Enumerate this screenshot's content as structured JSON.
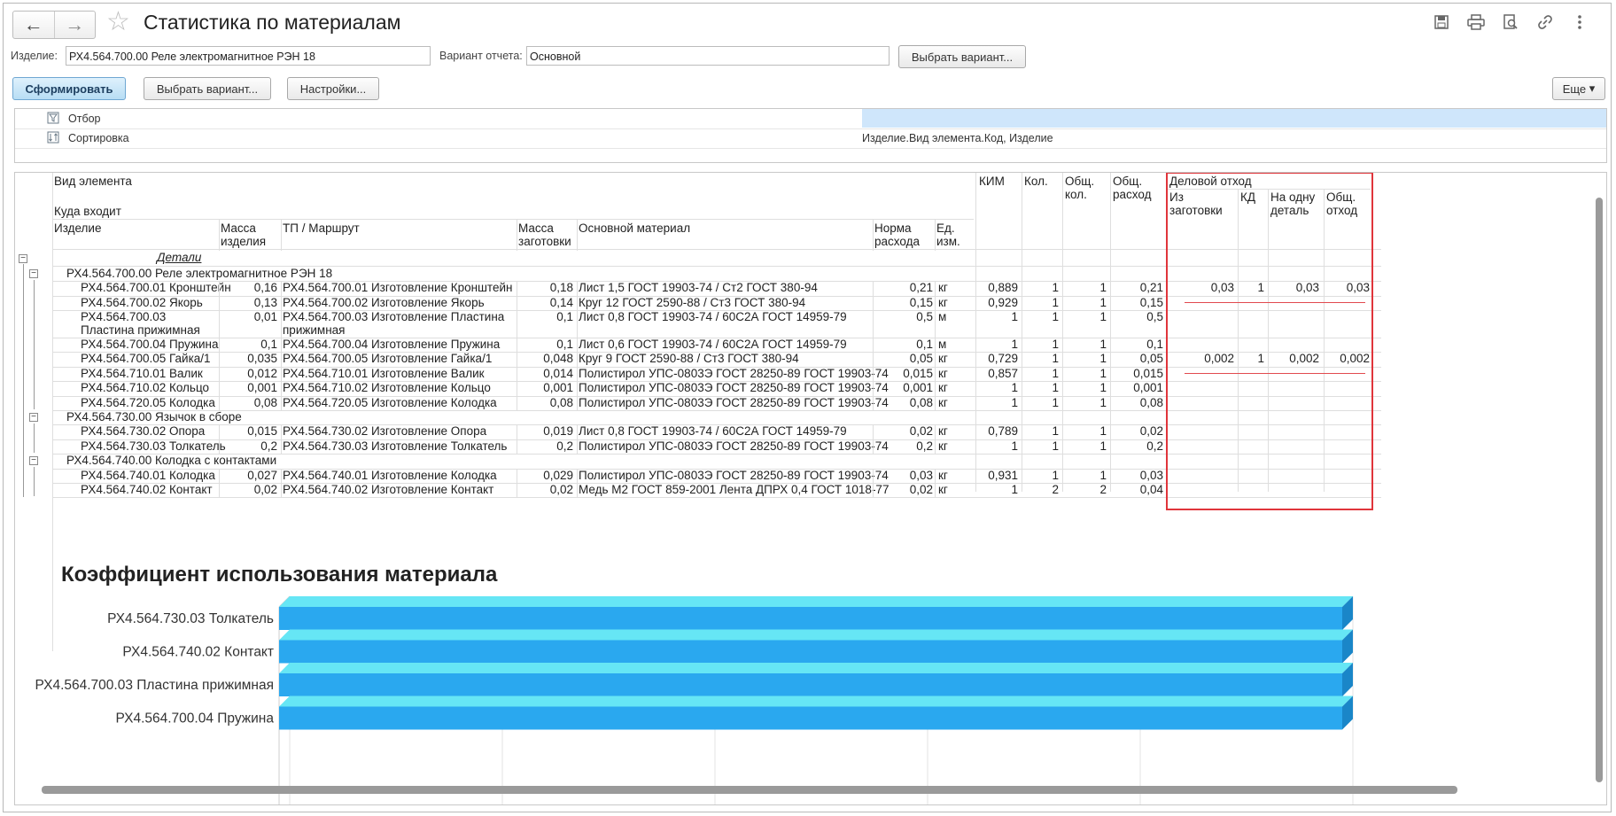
{
  "window": {
    "title": "Статистика по материалам"
  },
  "toolbar": {
    "back": "←",
    "forward": "→",
    "star": "☆",
    "icons": [
      "save-icon",
      "print-icon",
      "preview-icon",
      "link-icon",
      "more-icon"
    ]
  },
  "fields": {
    "product_label": "Изделие:",
    "product_value": "РХ4.564.700.00 Реле электромагнитное РЭН 18",
    "variant_label": "Вариант отчета:",
    "variant_value": "Основной",
    "choose_variant_top": "Выбрать вариант..."
  },
  "actions": {
    "generate": "Сформировать",
    "choose_variant": "Выбрать вариант...",
    "settings": "Настройки...",
    "more": "Еще"
  },
  "settings": {
    "rows": [
      {
        "name": "Отбор",
        "value": ""
      },
      {
        "name": "Сортировка",
        "value": "Изделие.Вид элемента.Код, Изделие"
      }
    ]
  },
  "table": {
    "headers": {
      "element_type": "Вид элемента",
      "goes_to": "Куда входит",
      "product": "Изделие",
      "mass_product": "Масса изделия",
      "tp_route": "ТП / Маршрут",
      "mass_blank": "Масса заготовки",
      "main_material": "Основной материал",
      "consumption_norm": "Норма расхода",
      "unit": "Ед. изм.",
      "kim": "КИМ",
      "qty": "Кол.",
      "total_qty": "Общ. кол.",
      "total_consumption": "Общ. расход",
      "business_waste": "Деловой отход",
      "from_blank": "Из заготовки",
      "kd": "КД",
      "per_part": "На одну деталь",
      "total_waste": "Общ. отход"
    },
    "group_title": "Детали",
    "groups": [
      {
        "name": "РХ4.564.700.00 Реле электромагнитное РЭН 18",
        "rows": [
          {
            "product": "РХ4.564.700.01 Кронштейн",
            "mass": "0,16",
            "tp": "РХ4.564.700.01 Изготовление Кронштейн",
            "mass_blank": "0,18",
            "material": "Лист 1,5  ГОСТ 19903-74 / Ст2  ГОСТ 380-94",
            "norm": "0,21",
            "unit": "кг",
            "kim": "0,889",
            "qty": "1",
            "total_qty": "1",
            "total_cons": "0,21",
            "from_blank": "0,03",
            "kd": "1",
            "per_part": "0,03",
            "total_waste": "0,03"
          },
          {
            "product": "РХ4.564.700.02 Якорь",
            "mass": "0,13",
            "tp": "РХ4.564.700.02 Изготовление Якорь",
            "mass_blank": "0,14",
            "material": "Круг 12  ГОСТ 2590-88 / Ст3  ГОСТ 380-94",
            "norm": "0,15",
            "unit": "кг",
            "kim": "0,929",
            "qty": "1",
            "total_qty": "1",
            "total_cons": "0,15",
            "from_blank": "",
            "kd": "",
            "per_part": "",
            "total_waste": ""
          },
          {
            "product": "РХ4.564.700.03 Пластина прижимная",
            "mass": "0,01",
            "tp": "РХ4.564.700.03 Изготовление Пластина прижимная",
            "mass_blank": "0,1",
            "material": "Лист 0,8  ГОСТ 19903-74 / 60С2А  ГОСТ 14959-79",
            "norm": "0,5",
            "unit": "м",
            "kim": "1",
            "qty": "1",
            "total_qty": "1",
            "total_cons": "0,5",
            "from_blank": "",
            "kd": "",
            "per_part": "",
            "total_waste": ""
          },
          {
            "product": "РХ4.564.700.04 Пружина",
            "mass": "0,1",
            "tp": "РХ4.564.700.04 Изготовление Пружина",
            "mass_blank": "0,1",
            "material": "Лист 0,6  ГОСТ 19903-74 / 60С2А  ГОСТ 14959-79",
            "norm": "0,1",
            "unit": "м",
            "kim": "1",
            "qty": "1",
            "total_qty": "1",
            "total_cons": "0,1",
            "from_blank": "",
            "kd": "",
            "per_part": "",
            "total_waste": ""
          },
          {
            "product": "РХ4.564.700.05 Гайка/1",
            "mass": "0,035",
            "tp": "РХ4.564.700.05 Изготовление Гайка/1",
            "mass_blank": "0,048",
            "material": "Круг 9  ГОСТ 2590-88 / Ст3  ГОСТ 380-94",
            "norm": "0,05",
            "unit": "кг",
            "kim": "0,729",
            "qty": "1",
            "total_qty": "1",
            "total_cons": "0,05",
            "from_blank": "0,002",
            "kd": "1",
            "per_part": "0,002",
            "total_waste": "0,002"
          },
          {
            "product": "РХ4.564.710.01 Валик",
            "mass": "0,012",
            "tp": "РХ4.564.710.01 Изготовление Валик",
            "mass_blank": "0,014",
            "material": "Полистирол УПС-0803Э  ГОСТ 28250-89  ГОСТ 19903-74",
            "norm": "0,015",
            "unit": "кг",
            "kim": "0,857",
            "qty": "1",
            "total_qty": "1",
            "total_cons": "0,015",
            "from_blank": "",
            "kd": "",
            "per_part": "",
            "total_waste": ""
          },
          {
            "product": "РХ4.564.710.02 Кольцо",
            "mass": "0,001",
            "tp": "РХ4.564.710.02 Изготовление Кольцо",
            "mass_blank": "0,001",
            "material": "Полистирол УПС-0803Э  ГОСТ 28250-89  ГОСТ 19903-74",
            "norm": "0,001",
            "unit": "кг",
            "kim": "1",
            "qty": "1",
            "total_qty": "1",
            "total_cons": "0,001",
            "from_blank": "",
            "kd": "",
            "per_part": "",
            "total_waste": ""
          },
          {
            "product": "РХ4.564.720.05 Колодка",
            "mass": "0,08",
            "tp": "РХ4.564.720.05 Изготовление Колодка",
            "mass_blank": "0,08",
            "material": "Полистирол УПС-0803Э  ГОСТ 28250-89  ГОСТ 19903-74",
            "norm": "0,08",
            "unit": "кг",
            "kim": "1",
            "qty": "1",
            "total_qty": "1",
            "total_cons": "0,08",
            "from_blank": "",
            "kd": "",
            "per_part": "",
            "total_waste": ""
          }
        ]
      },
      {
        "name": "РХ4.564.730.00 Язычок в сборе",
        "rows": [
          {
            "product": "РХ4.564.730.02 Опора",
            "mass": "0,015",
            "tp": "РХ4.564.730.02 Изготовление Опора",
            "mass_blank": "0,019",
            "material": "Лист 0,8  ГОСТ 19903-74 / 60С2А  ГОСТ 14959-79",
            "norm": "0,02",
            "unit": "кг",
            "kim": "0,789",
            "qty": "1",
            "total_qty": "1",
            "total_cons": "0,02",
            "from_blank": "",
            "kd": "",
            "per_part": "",
            "total_waste": ""
          },
          {
            "product": "РХ4.564.730.03 Толкатель",
            "mass": "0,2",
            "tp": "РХ4.564.730.03 Изготовление Толкатель",
            "mass_blank": "0,2",
            "material": "Полистирол УПС-0803Э  ГОСТ 28250-89  ГОСТ 19903-74",
            "norm": "0,2",
            "unit": "кг",
            "kim": "1",
            "qty": "1",
            "total_qty": "1",
            "total_cons": "0,2",
            "from_blank": "",
            "kd": "",
            "per_part": "",
            "total_waste": ""
          }
        ]
      },
      {
        "name": "РХ4.564.740.00 Колодка с контактами",
        "rows": [
          {
            "product": "РХ4.564.740.01 Колодка",
            "mass": "0,027",
            "tp": "РХ4.564.740.01 Изготовление Колодка",
            "mass_blank": "0,029",
            "material": "Полистирол УПС-0803Э  ГОСТ 28250-89  ГОСТ 19903-74",
            "norm": "0,03",
            "unit": "кг",
            "kim": "0,931",
            "qty": "1",
            "total_qty": "1",
            "total_cons": "0,03",
            "from_blank": "",
            "kd": "",
            "per_part": "",
            "total_waste": ""
          },
          {
            "product": "РХ4.564.740.02 Контакт",
            "mass": "0,02",
            "tp": "РХ4.564.740.02 Изготовление Контакт",
            "mass_blank": "0,02",
            "material": "Медь М2 ГОСТ 859-2001 Лента ДПРХ  0,4 ГОСТ 1018-77",
            "norm": "0,02",
            "unit": "кг",
            "kim": "1",
            "qty": "2",
            "total_qty": "2",
            "total_cons": "0,04",
            "from_blank": "",
            "kd": "",
            "per_part": "",
            "total_waste": ""
          }
        ]
      }
    ]
  },
  "chart_data": {
    "type": "bar",
    "title": "Коэффициент использования материала",
    "orientation": "horizontal",
    "categories": [
      "РХ4.564.730.03 Толкатель",
      "РХ4.564.740.02 Контакт",
      "РХ4.564.700.03 Пластина прижимная",
      "РХ4.564.700.04 Пружина"
    ],
    "values": [
      1,
      1,
      1,
      1
    ],
    "xlim": [
      0,
      1
    ],
    "grid": true,
    "style": "3d",
    "colors": {
      "bar": "#2aa8ef",
      "bar_top": "#66e6f5",
      "bar_side": "#1a86c8"
    }
  },
  "colors": {
    "accent_button": "#b7ddf4",
    "highlight": "#cfe6fb",
    "red_frame": "#e0353b"
  }
}
